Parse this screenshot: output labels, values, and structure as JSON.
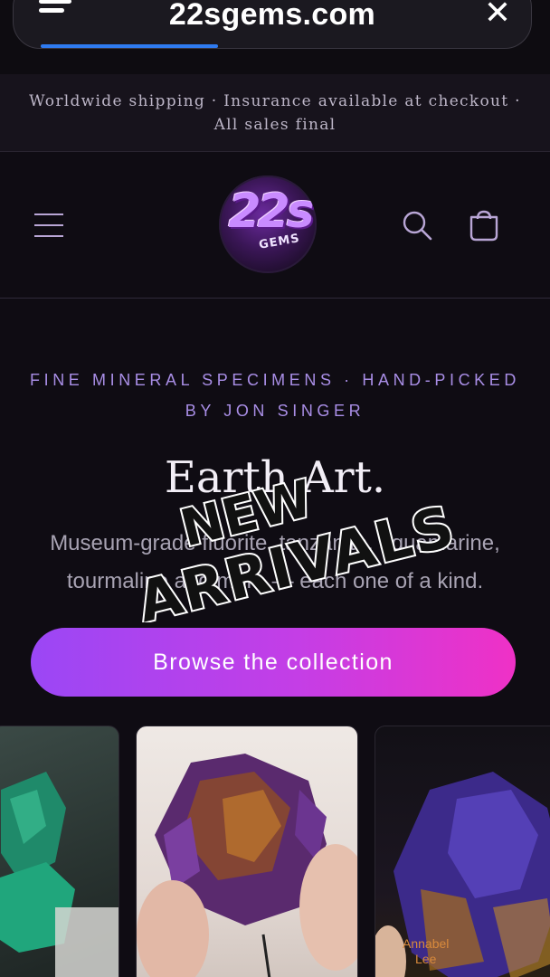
{
  "browser": {
    "url": "22sgems.com",
    "menu_icon": "menu-icon",
    "close_icon": "close-icon",
    "close_glyph": "✕",
    "load_progress": 0.35
  },
  "announcement": {
    "text": "Worldwide shipping · Insurance available at checkout · All sales final"
  },
  "header": {
    "logo_text": "22s",
    "logo_subtext": "GEMS",
    "menu_icon": "hamburger-icon",
    "search_icon": "search-icon",
    "cart_icon": "cart-icon"
  },
  "hero": {
    "kicker_line1": "FINE MINERAL SPECIMENS · HAND-PICKED",
    "kicker_line2": "BY JON SINGER",
    "title": "Earth Art.",
    "subtitle": "Museum-grade fluorite, tanzanite, aquamarine, tourmaline and more — each one of a kind.",
    "cta_label": "Browse the collection"
  },
  "sticker": {
    "line1": "NEW",
    "line2": "ARRIVALS"
  },
  "products": [
    {
      "image": "green fluorite specimen"
    },
    {
      "image": "purple fluorite cluster held in hand"
    },
    {
      "image": "purple fluorite on matrix",
      "watermark": "Annabel Lee"
    }
  ],
  "colors": {
    "accent_start": "#9b47f5",
    "accent_end": "#ef31c6",
    "kicker": "#a98ee6",
    "background": "#0f0c13"
  }
}
